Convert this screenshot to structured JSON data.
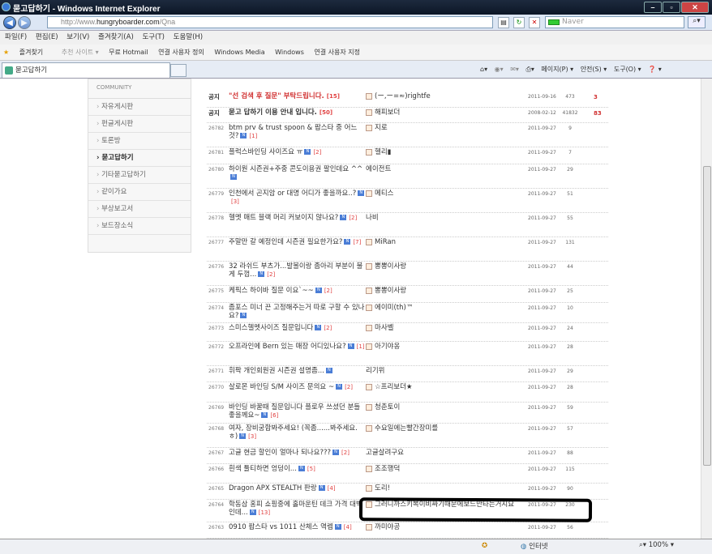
{
  "window": {
    "title": "묻고답하기 - Windows Internet Explorer"
  },
  "address": {
    "prefix": "http://www.",
    "domain": "hungryboarder.com",
    "path": "/Qna",
    "search_placeholder": "Naver"
  },
  "menu": [
    "파일(F)",
    "편집(E)",
    "보기(V)",
    "즐겨찾기(A)",
    "도구(T)",
    "도움말(H)"
  ],
  "favorites": {
    "label": "즐겨찾기",
    "items": [
      "추천 사이트 ▾",
      "무료 Hotmail",
      "연결 사용자 정의",
      "Windows Media",
      "Windows",
      "연결 사용자 지정"
    ]
  },
  "tab": {
    "title": "묻고답하기"
  },
  "tools": [
    "페이지(P) ▾",
    "안전(S) ▾",
    "도구(O) ▾",
    "❓ ▾"
  ],
  "sidebar": {
    "brand": "COMMUNITY",
    "items": [
      "자유게시판",
      "펀글게시판",
      "토론방",
      "묻고답하기",
      "기타묻고답하기",
      "같이가요",
      "부상보고서",
      "보드장소식"
    ],
    "active": 3
  },
  "board": {
    "rows": [
      {
        "num": "공지",
        "title": "\"선 검색 후 질문\" 부탁드립니다.",
        "comments": "[15]",
        "author": "(ー,ー=≈)rightfe",
        "date": "2011-09-16",
        "hits": "473",
        "rec": "3"
      },
      {
        "num": "공지",
        "title": "묻고 답하기 이용 안내 입니다.",
        "comments": "[50]",
        "author": "해피보더",
        "date": "2008-02-12",
        "hits": "41832",
        "rec": "83"
      },
      {
        "num": "26782",
        "title": "btm prv & trust spoon & 팝스타 중 어느것?",
        "comments": "[1]",
        "author": "지로",
        "date": "2011-09-27",
        "hits": "9",
        "rec": ""
      },
      {
        "num": "26781",
        "title": "플럭스바인딩 사이즈요 ㅠ",
        "comments": "[2]",
        "author": "헬리▮",
        "date": "2011-09-27",
        "hits": "7",
        "rec": ""
      },
      {
        "num": "26780",
        "title": "하이원 시즌권+주중 콘도이용권 팔인데요 ^^",
        "comments": "",
        "author": "에이전트",
        "date": "2011-09-27",
        "hits": "29",
        "rec": ""
      },
      {
        "num": "26779",
        "title": "인천에서 곤지암 or 대명 어디가 좋을까요..?",
        "comments": "[3]",
        "author": "메티스",
        "date": "2011-09-27",
        "hits": "51",
        "rec": ""
      },
      {
        "num": "26778",
        "title": "헬멧 매트 블랙 머리 커보이지 않나요?",
        "comments": "[2]",
        "author": "나비",
        "date": "2011-09-27",
        "hits": "55",
        "rec": ""
      },
      {
        "num": "26777",
        "title": "주말만 갈 예정인데 시즌권 필요한가요?",
        "comments": "[7]",
        "author": "MiRan",
        "date": "2011-09-27",
        "hits": "131",
        "rec": ""
      },
      {
        "num": "26776",
        "title": "32 라쉬드 부츠가...발볼이랑 좀아리 부분이 불게 두껍...",
        "comments": "[2]",
        "author": "뽕뽕이사랑",
        "date": "2011-09-27",
        "hits": "44",
        "rec": ""
      },
      {
        "num": "26775",
        "title": "케픽스 하이바 질문 이요`~~",
        "comments": "[2]",
        "author": "뽕뽕이사랑",
        "date": "2011-09-27",
        "hits": "25",
        "rec": ""
      },
      {
        "num": "26774",
        "title": "좀포스 미너 끈 고정해주는거 따로 구할 수 있나요?",
        "comments": "",
        "author": "에이미(th)™",
        "date": "2011-09-27",
        "hits": "10",
        "rec": ""
      },
      {
        "num": "26773",
        "title": "스미스헬멧사이즈 질문입니다",
        "comments": "[2]",
        "author": "마사벨",
        "date": "2011-09-27",
        "hits": "24",
        "rec": ""
      },
      {
        "num": "26772",
        "title": "오프라인에 Bern 있는 매장 어디있나요?",
        "comments": "[1]",
        "author": "아기야옹",
        "date": "2011-09-27",
        "hits": "28",
        "rec": ""
      },
      {
        "num": "26771",
        "title": "휘팍 개인회원권 시즌권 설명좀...",
        "comments": "",
        "author": "리기뮈",
        "date": "2011-09-27",
        "hits": "29",
        "rec": ""
      },
      {
        "num": "26770",
        "title": "살로몬 바인딩 S/M 사이즈 문의요 ~",
        "comments": "[2]",
        "author": "☆프리보더★",
        "date": "2011-09-27",
        "hits": "28",
        "rec": ""
      },
      {
        "num": "26769",
        "title": "바인딩 바꿀때 질문입니다 플로우 쓰셨던 분들 좋을께요~",
        "comments": "[6]",
        "author": "청춘토이",
        "date": "2011-09-27",
        "hits": "59",
        "rec": ""
      },
      {
        "num": "26768",
        "title": "여자, 장비궁합봐주세요! (꼭좀......봐주세요.ㅎ)",
        "comments": "[3]",
        "author": "수요일에는빨간장미를",
        "date": "2011-09-27",
        "hits": "57",
        "rec": ""
      },
      {
        "num": "26767",
        "title": "고글 현금 할인이 얼마나 되나요???",
        "comments": "[2]",
        "author": "고글살려구요",
        "date": "2011-09-27",
        "hits": "88",
        "rec": ""
      },
      {
        "num": "26766",
        "title": "흰색 툴티하면 엉덩이...",
        "comments": "[5]",
        "author": "조조행덕",
        "date": "2011-09-27",
        "hits": "115",
        "rec": ""
      },
      {
        "num": "26765",
        "title": "Dragon APX STEALTH 판랑",
        "comments": "[4]",
        "author": "도리!",
        "date": "2011-09-27",
        "hits": "90",
        "rec": ""
      },
      {
        "num": "26764",
        "title": "학동삼 홍피 쇼핑중에 홀마운틴 데크 가격 대박인데...",
        "comments": "[13]",
        "author": "그러니까스키복이비싸기때문에보드만타는거지요",
        "date": "2011-09-27",
        "hits": "230",
        "rec": ""
      },
      {
        "num": "26763",
        "title": "0910 팝스타 vs 1011 산체스 역렘",
        "comments": "[4]",
        "author": "까미야공",
        "date": "2011-09-27",
        "hits": "56",
        "rec": ""
      }
    ]
  },
  "status": {
    "zone": "인터넷",
    "zoom": "100%"
  }
}
